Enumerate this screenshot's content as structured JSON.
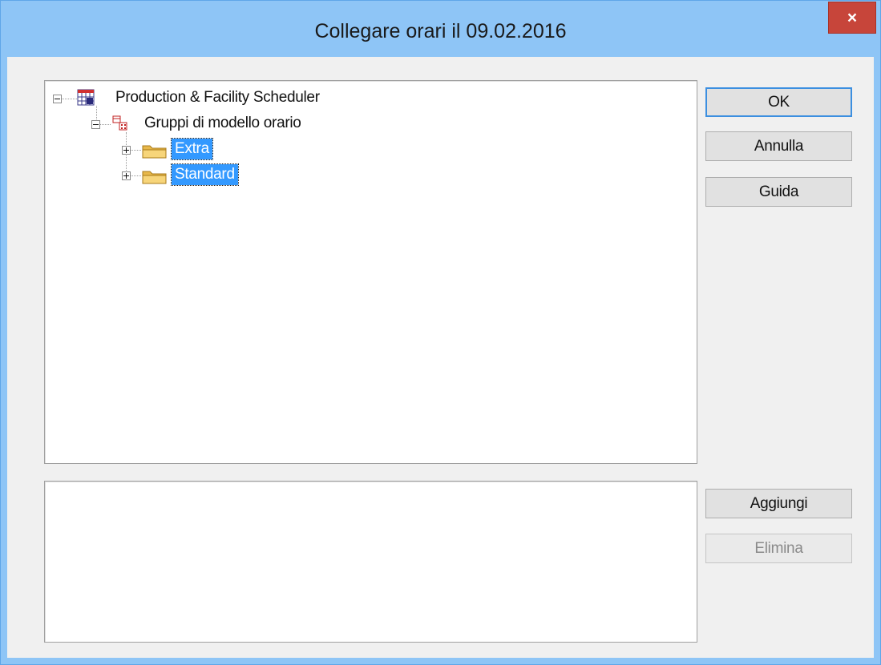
{
  "window": {
    "title": "Collegare orari il 09.02.2016",
    "close_glyph": "×"
  },
  "tree": {
    "root": {
      "label": "Production & Facility Scheduler",
      "icon": "calendar-icon",
      "expanded": true
    },
    "group": {
      "label": "Gruppi di modello orario",
      "icon": "schedule-template-icon",
      "expanded": true
    },
    "folders": [
      {
        "label": "Extra",
        "icon": "folder-icon",
        "expanded": false,
        "selected": true
      },
      {
        "label": "Standard",
        "icon": "folder-icon",
        "expanded": false,
        "selected": true
      }
    ]
  },
  "buttons": {
    "ok": "OK",
    "cancel": "Annulla",
    "help": "Guida",
    "add": "Aggiungi",
    "delete": "Elimina"
  },
  "colors": {
    "title_bar": "#8ec5f6",
    "close_button": "#c7453a",
    "selection": "#3399ff",
    "default_button_border": "#3c8fe0"
  }
}
